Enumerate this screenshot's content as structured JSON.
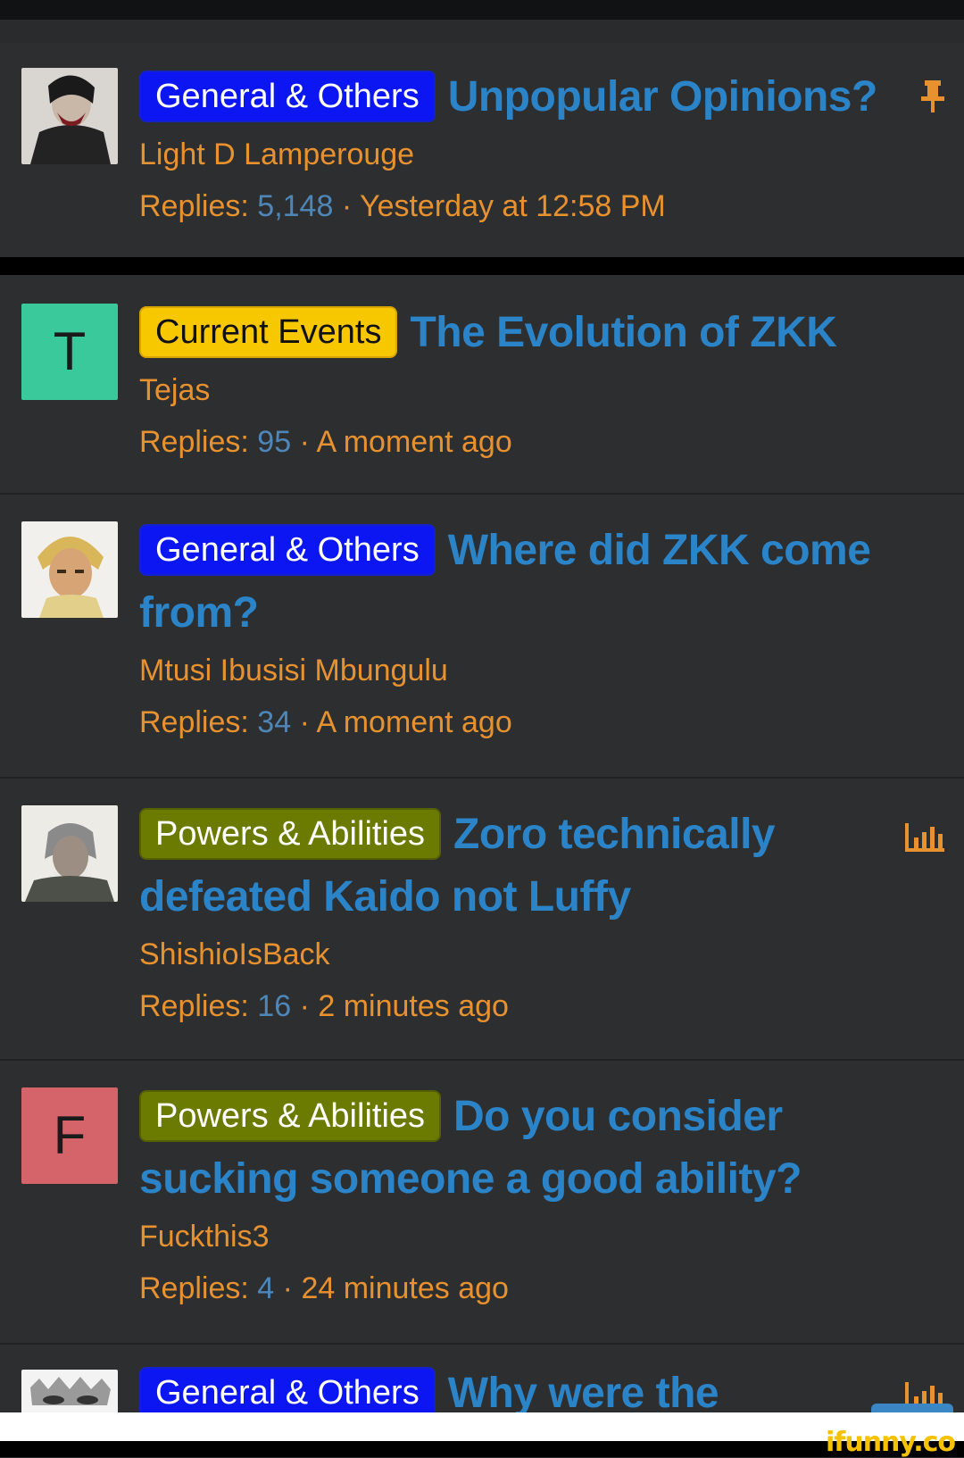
{
  "watermark": "ifunny.co",
  "threads": [
    {
      "prefix": "General & Others",
      "title": "Unpopular Opinions?",
      "author": "Light D Lamperouge",
      "replies_label": "Replies:",
      "replies": "5,148",
      "time": "Yesterday at 12:58 PM",
      "avatar_letter": "",
      "status_icon": "pin-icon"
    },
    {
      "prefix": "Current Events",
      "title": "The Evolution of ZKK",
      "author": "Tejas",
      "replies_label": "Replies:",
      "replies": "95",
      "time": "A moment ago",
      "avatar_letter": "T",
      "avatar_color": "#3ac99a"
    },
    {
      "prefix": "General & Others",
      "title": "Where did ZKK come from?",
      "author": "Mtusi Ibusisi Mbungulu",
      "replies_label": "Replies:",
      "replies": "34",
      "time": "A moment ago",
      "avatar_letter": ""
    },
    {
      "prefix": "Powers & Abilities",
      "title": "Zoro technically defeated Kaido not Luffy",
      "author": "ShishioIsBack",
      "replies_label": "Replies:",
      "replies": "16",
      "time": "2 minutes ago",
      "avatar_letter": "",
      "status_icon": "poll-icon"
    },
    {
      "prefix": "Powers & Abilities",
      "title": "Do you consider sucking someone a good ability?",
      "author": "Fuckthis3",
      "replies_label": "Replies:",
      "replies": "4",
      "time": "24 minutes ago",
      "avatar_letter": "F",
      "avatar_color": "#d4646a"
    },
    {
      "prefix": "General & Others",
      "title": "Why were the",
      "status_icon": "poll-icon"
    }
  ],
  "colors": {
    "title": "#2b84c8",
    "meta": "#e8922f",
    "count": "#4e86b8",
    "prefix_blue": "#0b16f3",
    "prefix_yellow": "#f7c800",
    "prefix_olive": "#6b7a00"
  }
}
